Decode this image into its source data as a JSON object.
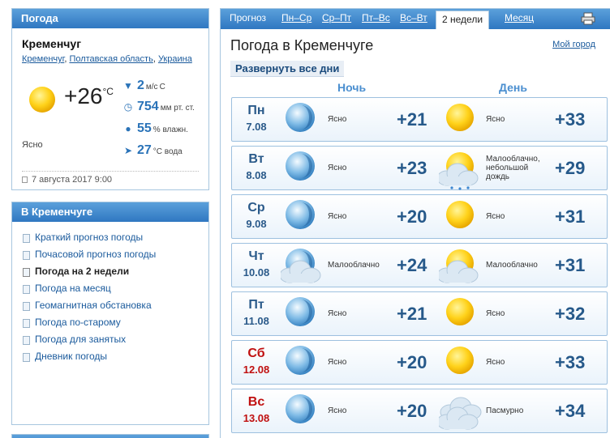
{
  "widget": {
    "header": "Погода",
    "city": "Кременчуг",
    "breadcrumb": [
      "Кременчуг",
      "Полтавская область",
      "Украина"
    ],
    "temp": "+26",
    "temp_unit": "°C",
    "condition": "Ясно",
    "wind": {
      "value": "2",
      "unit": "м/с",
      "dir": "С"
    },
    "pressure": {
      "value": "754",
      "unit": "мм рт. ст."
    },
    "humidity": {
      "value": "55",
      "unit": "% влажн."
    },
    "water": {
      "value": "27",
      "unit": "°C вода"
    },
    "updated": "7 августа 2017 9:00"
  },
  "city_menu": {
    "header": "В Кременчуге",
    "items": [
      "Краткий прогноз погоды",
      "Почасовой прогноз погоды",
      "Погода на 2 недели",
      "Погода на месяц",
      "Геомагнитная обстановка",
      "Погода по-старому",
      "Погода для занятых",
      "Дневник погоды"
    ],
    "active_index": 2
  },
  "tabs": {
    "label": "Прогноз",
    "items": [
      "Пн–Ср",
      "Ср–Пт",
      "Пт–Вс",
      "Вс–Вт",
      "2 недели",
      "Месяц"
    ],
    "selected": "2 недели"
  },
  "forecast": {
    "title": "Погода в Кременчуге",
    "my_city": "Мой город",
    "expand": "Развернуть все дни",
    "night": "Ночь",
    "day": "День",
    "days": [
      {
        "d": "Пн",
        "dt": "7.08",
        "weekend": false,
        "n_icon": "moon-icon",
        "n_cond": "Ясно",
        "n_t": "+21",
        "d_icon": "sun-icon",
        "d_cond": "Ясно",
        "d_t": "+33"
      },
      {
        "d": "Вт",
        "dt": "8.08",
        "weekend": false,
        "n_icon": "moon-icon",
        "n_cond": "Ясно",
        "n_t": "+23",
        "d_icon": "sun-cloud-rain-icon",
        "d_cond": "Малооблачно, небольшой дождь",
        "d_t": "+29"
      },
      {
        "d": "Ср",
        "dt": "9.08",
        "weekend": false,
        "n_icon": "moon-icon",
        "n_cond": "Ясно",
        "n_t": "+20",
        "d_icon": "sun-icon",
        "d_cond": "Ясно",
        "d_t": "+31"
      },
      {
        "d": "Чт",
        "dt": "10.08",
        "weekend": false,
        "n_icon": "moon-cloud-icon",
        "n_cond": "Малооблачно",
        "n_t": "+24",
        "d_icon": "sun-cloud-icon",
        "d_cond": "Малооблачно",
        "d_t": "+31"
      },
      {
        "d": "Пт",
        "dt": "11.08",
        "weekend": false,
        "n_icon": "moon-icon",
        "n_cond": "Ясно",
        "n_t": "+21",
        "d_icon": "sun-icon",
        "d_cond": "Ясно",
        "d_t": "+32"
      },
      {
        "d": "Сб",
        "dt": "12.08",
        "weekend": true,
        "n_icon": "moon-icon",
        "n_cond": "Ясно",
        "n_t": "+20",
        "d_icon": "sun-icon",
        "d_cond": "Ясно",
        "d_t": "+33"
      },
      {
        "d": "Вс",
        "dt": "13.08",
        "weekend": true,
        "n_icon": "moon-icon",
        "n_cond": "Ясно",
        "n_t": "+20",
        "d_icon": "clouds-icon",
        "d_cond": "Пасмурно",
        "d_t": "+34"
      }
    ]
  },
  "colors": {
    "accent": "#2f77c1",
    "weekend": "#c01010",
    "temp": "#26598a"
  }
}
